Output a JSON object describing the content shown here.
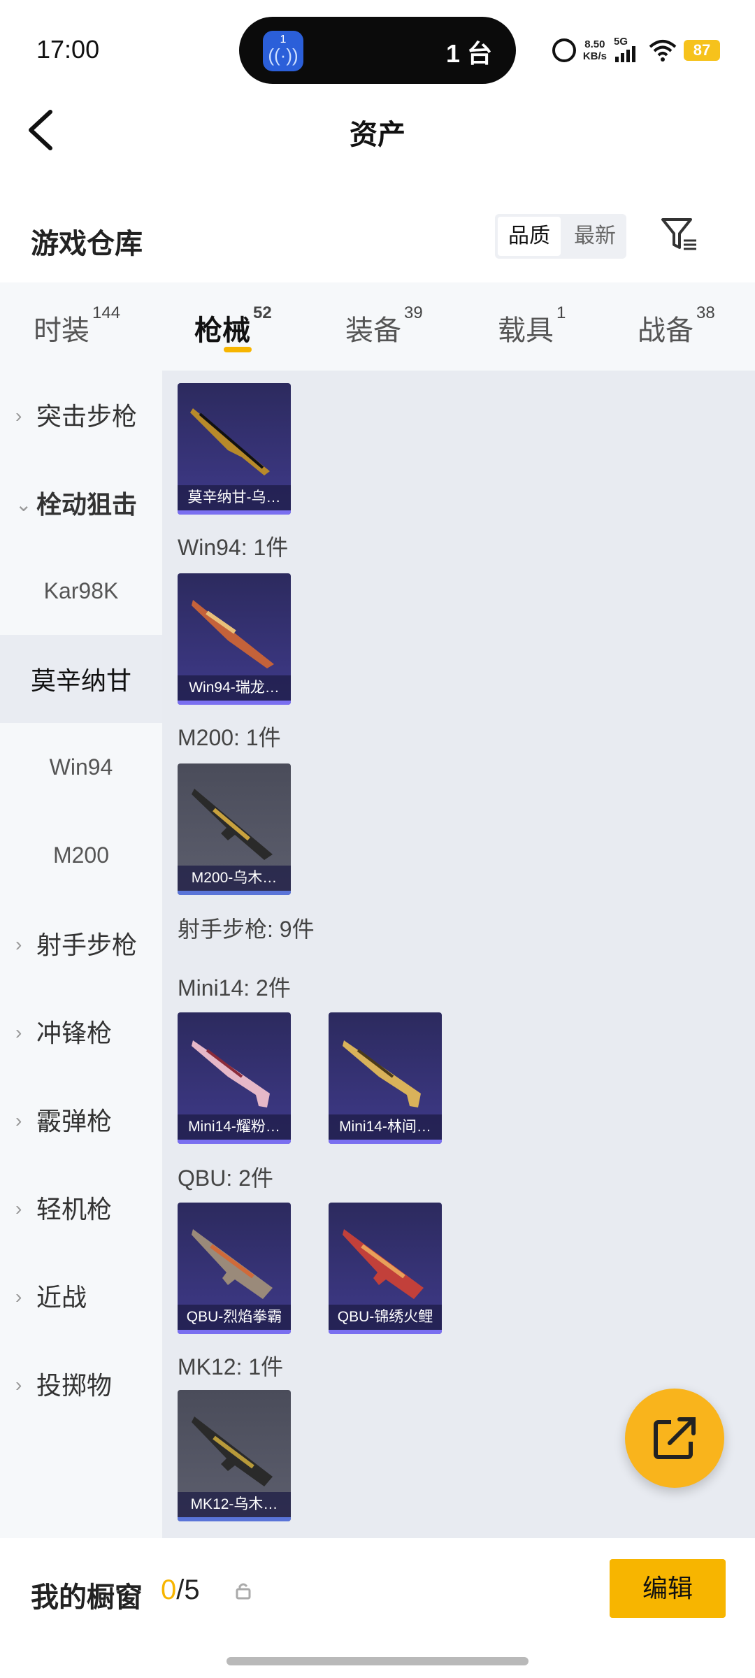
{
  "status": {
    "time": "17:00",
    "island_text": "1 台",
    "island_badge": "1",
    "speed_value": "8.50",
    "speed_unit": "KB/s",
    "network": "5G",
    "battery": "87"
  },
  "header": {
    "title": "资产"
  },
  "warehouse": {
    "title": "游戏仓库",
    "sort": [
      "品质",
      "最新"
    ],
    "sort_active": "品质"
  },
  "tabs": [
    {
      "label": "时装",
      "count": "144"
    },
    {
      "label": "枪械",
      "count": "52",
      "active": true
    },
    {
      "label": "装备",
      "count": "39"
    },
    {
      "label": "载具",
      "count": "1"
    },
    {
      "label": "战备",
      "count": "38"
    }
  ],
  "sidebar": [
    {
      "label": "突击步枪",
      "type": "category"
    },
    {
      "label": "栓动狙击",
      "type": "category",
      "open": true
    },
    {
      "label": "Kar98K",
      "type": "sub"
    },
    {
      "label": "莫辛纳甘",
      "type": "sub",
      "selected": true
    },
    {
      "label": "Win94",
      "type": "sub"
    },
    {
      "label": "M200",
      "type": "sub"
    },
    {
      "label": "射手步枪",
      "type": "category"
    },
    {
      "label": "冲锋枪",
      "type": "category"
    },
    {
      "label": "霰弹枪",
      "type": "category"
    },
    {
      "label": "轻机枪",
      "type": "category"
    },
    {
      "label": "近战",
      "type": "category"
    },
    {
      "label": "投掷物",
      "type": "category"
    }
  ],
  "content": {
    "labels": {
      "win94": "Win94: 1件",
      "m200": "M200: 1件",
      "marksman": "射手步枪: 9件",
      "mini14": "Mini14: 2件",
      "qbu": "QBU: 2件",
      "mk12": "MK12: 1件"
    },
    "cards": [
      {
        "name": "莫辛纳甘-乌…",
        "tone": "purple"
      },
      {
        "name": "Win94-瑞龙…",
        "tone": "purple"
      },
      {
        "name": "M200-乌木…",
        "tone": "gray"
      },
      {
        "name": "Mini14-耀粉…",
        "tone": "purple"
      },
      {
        "name": "Mini14-林间…",
        "tone": "purple"
      },
      {
        "name": "QBU-烈焰拳霸",
        "tone": "purple"
      },
      {
        "name": "QBU-锦绣火鲤",
        "tone": "purple"
      },
      {
        "name": "MK12-乌木…",
        "tone": "gray"
      }
    ]
  },
  "bottom": {
    "showcase_label": "我的橱窗",
    "showcase_current": "0",
    "showcase_total": "/5",
    "edit_label": "编辑"
  },
  "colors": {
    "accent": "#f7b500",
    "card_purple": "#3f3a8a",
    "card_gray": "#5d5f6e",
    "fab": "#f9b41c"
  },
  "icons": [
    "back-icon",
    "filter-icon",
    "share-icon",
    "lock-icon",
    "alarm-icon",
    "wifi-icon"
  ]
}
